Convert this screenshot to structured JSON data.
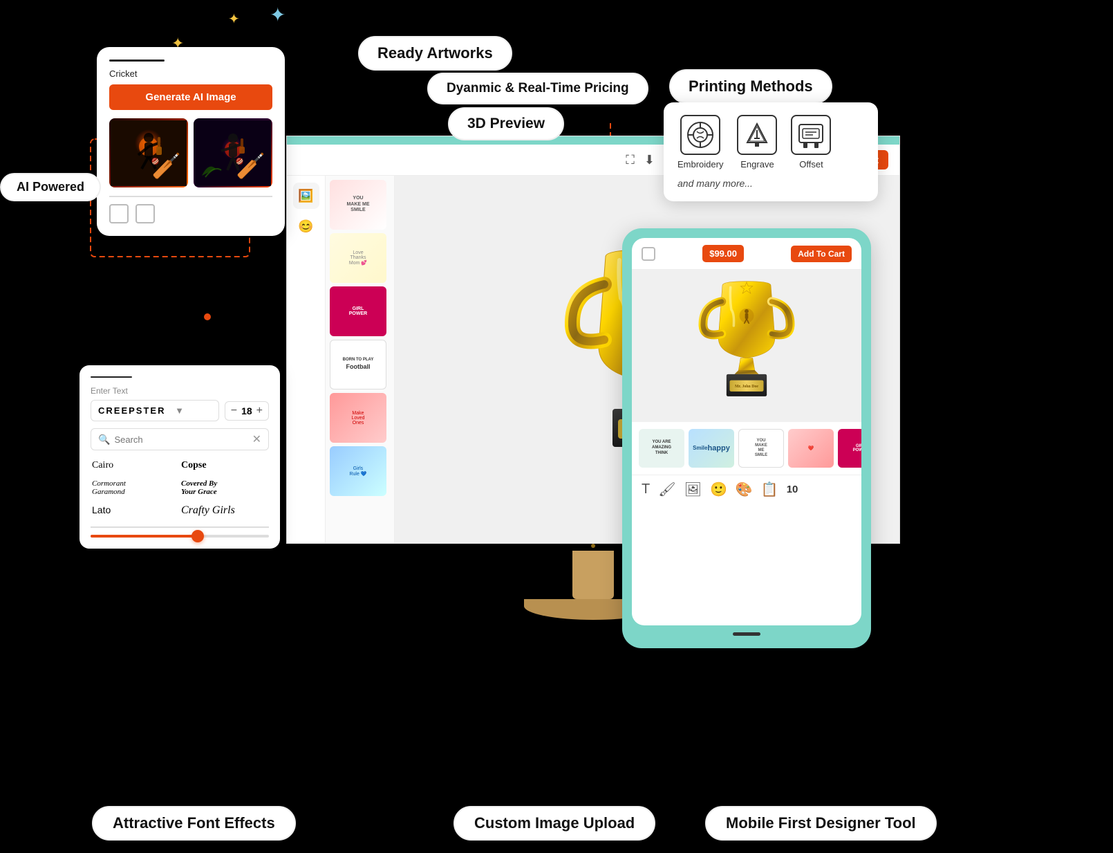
{
  "page": {
    "background": "#000000"
  },
  "callouts": {
    "ready_artworks": "Ready Artworks",
    "dynamic_pricing": "Dyanmic & Real-Time Pricing",
    "preview_3d": "3D Preview",
    "printing_methods": "Printing Methods",
    "ai_powered": "AI Powered",
    "attractive_font": "Attractive Font Effects",
    "custom_image": "Custom Image Upload",
    "mobile_first": "Mobile First Designer Tool"
  },
  "ai_panel": {
    "label": "Cricket",
    "button": "Generate AI Image",
    "img1_alt": "Cricket player silhouette 1",
    "img2_alt": "Cricket player silhouette 2"
  },
  "designer": {
    "price": "$99.00",
    "add_to_cart": "Add To Cart",
    "trophy_name": "Mr. John Doe"
  },
  "font_panel": {
    "placeholder": "Enter Text",
    "font_name": "CREEPSTER",
    "font_size": "18",
    "search_placeholder": "Search",
    "fonts": [
      {
        "name": "Cairo",
        "style": "normal"
      },
      {
        "name": "Copse",
        "style": "bold"
      },
      {
        "name": "Cormorant Garamond",
        "style": "italic"
      },
      {
        "name": "Covered By Your Grace",
        "style": "cursive"
      },
      {
        "name": "Lato",
        "style": "normal"
      },
      {
        "name": "Crafty Girls",
        "style": "cursive"
      }
    ]
  },
  "printing": {
    "methods": [
      {
        "name": "Embroidery",
        "icon": "🪡"
      },
      {
        "name": "Engrave",
        "icon": "🔧"
      },
      {
        "name": "Offset",
        "icon": "🖨️"
      }
    ],
    "more_text": "and many more..."
  },
  "mobile": {
    "price": "$99.00",
    "add_to_cart": "Add To Cart",
    "trophy_name": "Mr. John Doe",
    "tool_count": "10"
  },
  "artworks": [
    {
      "label": "YOU MAKE ME SMILE",
      "style": "sticker1"
    },
    {
      "label": "BORN TO PLAY Football",
      "style": "football"
    },
    {
      "label": "Love Thanks Mom",
      "style": "sticker2"
    },
    {
      "label": "GIRL POWER",
      "style": "girl"
    },
    {
      "label": "Make Loved Ones",
      "style": "loved"
    },
    {
      "label": "Girls Rule",
      "style": "girls2"
    }
  ]
}
